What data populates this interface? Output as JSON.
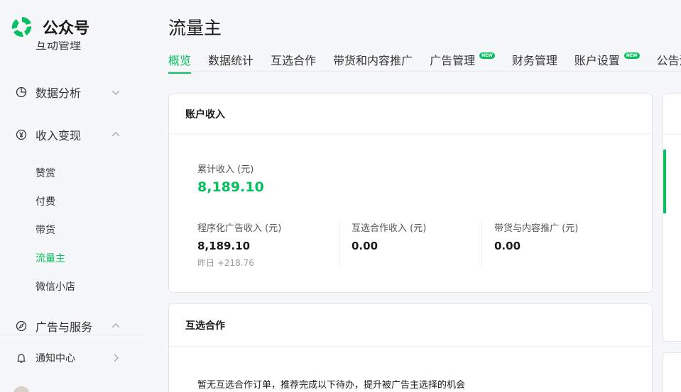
{
  "brand": {
    "name": "公众号",
    "accent": "#07c160"
  },
  "sidebar": {
    "cut_item_label": "互动管理",
    "groups": [
      {
        "label": "数据分析",
        "icon": "pie-chart-icon",
        "expanded": false
      },
      {
        "label": "收入变现",
        "icon": "yen-icon",
        "expanded": true
      },
      {
        "label": "广告与服务",
        "icon": "compass-icon",
        "expanded": true
      },
      {
        "label": "通知中心",
        "icon": "bell-icon"
      }
    ],
    "income_items": [
      {
        "label": "赞赏"
      },
      {
        "label": "付费"
      },
      {
        "label": "带货"
      },
      {
        "label": "流量主",
        "active": true
      },
      {
        "label": "微信小店"
      }
    ]
  },
  "page": {
    "title": "流量主"
  },
  "tabs": [
    {
      "label": "概览",
      "active": true
    },
    {
      "label": "数据统计"
    },
    {
      "label": "互选合作"
    },
    {
      "label": "带货和内容推广"
    },
    {
      "label": "广告管理",
      "badge": "NEW"
    },
    {
      "label": "财务管理"
    },
    {
      "label": "账户设置",
      "badge": "NEW"
    },
    {
      "label": "公告消息"
    }
  ],
  "income_card": {
    "title": "账户收入",
    "total_label": "累计收入 (元)",
    "total_value": "8,189.10",
    "breakdown": [
      {
        "label": "程序化广告收入 (元)",
        "value": "8,189.10",
        "yesterday": "昨日 +218.76"
      },
      {
        "label": "互选合作收入 (元)",
        "value": "0.00"
      },
      {
        "label": "带货与内容推广 (元)",
        "value": "0.00"
      }
    ]
  },
  "mutual_card": {
    "title": "互选合作",
    "empty_text": "暂无互选合作订单，推荐完成以下待办，提升被广告主选择的机会"
  }
}
